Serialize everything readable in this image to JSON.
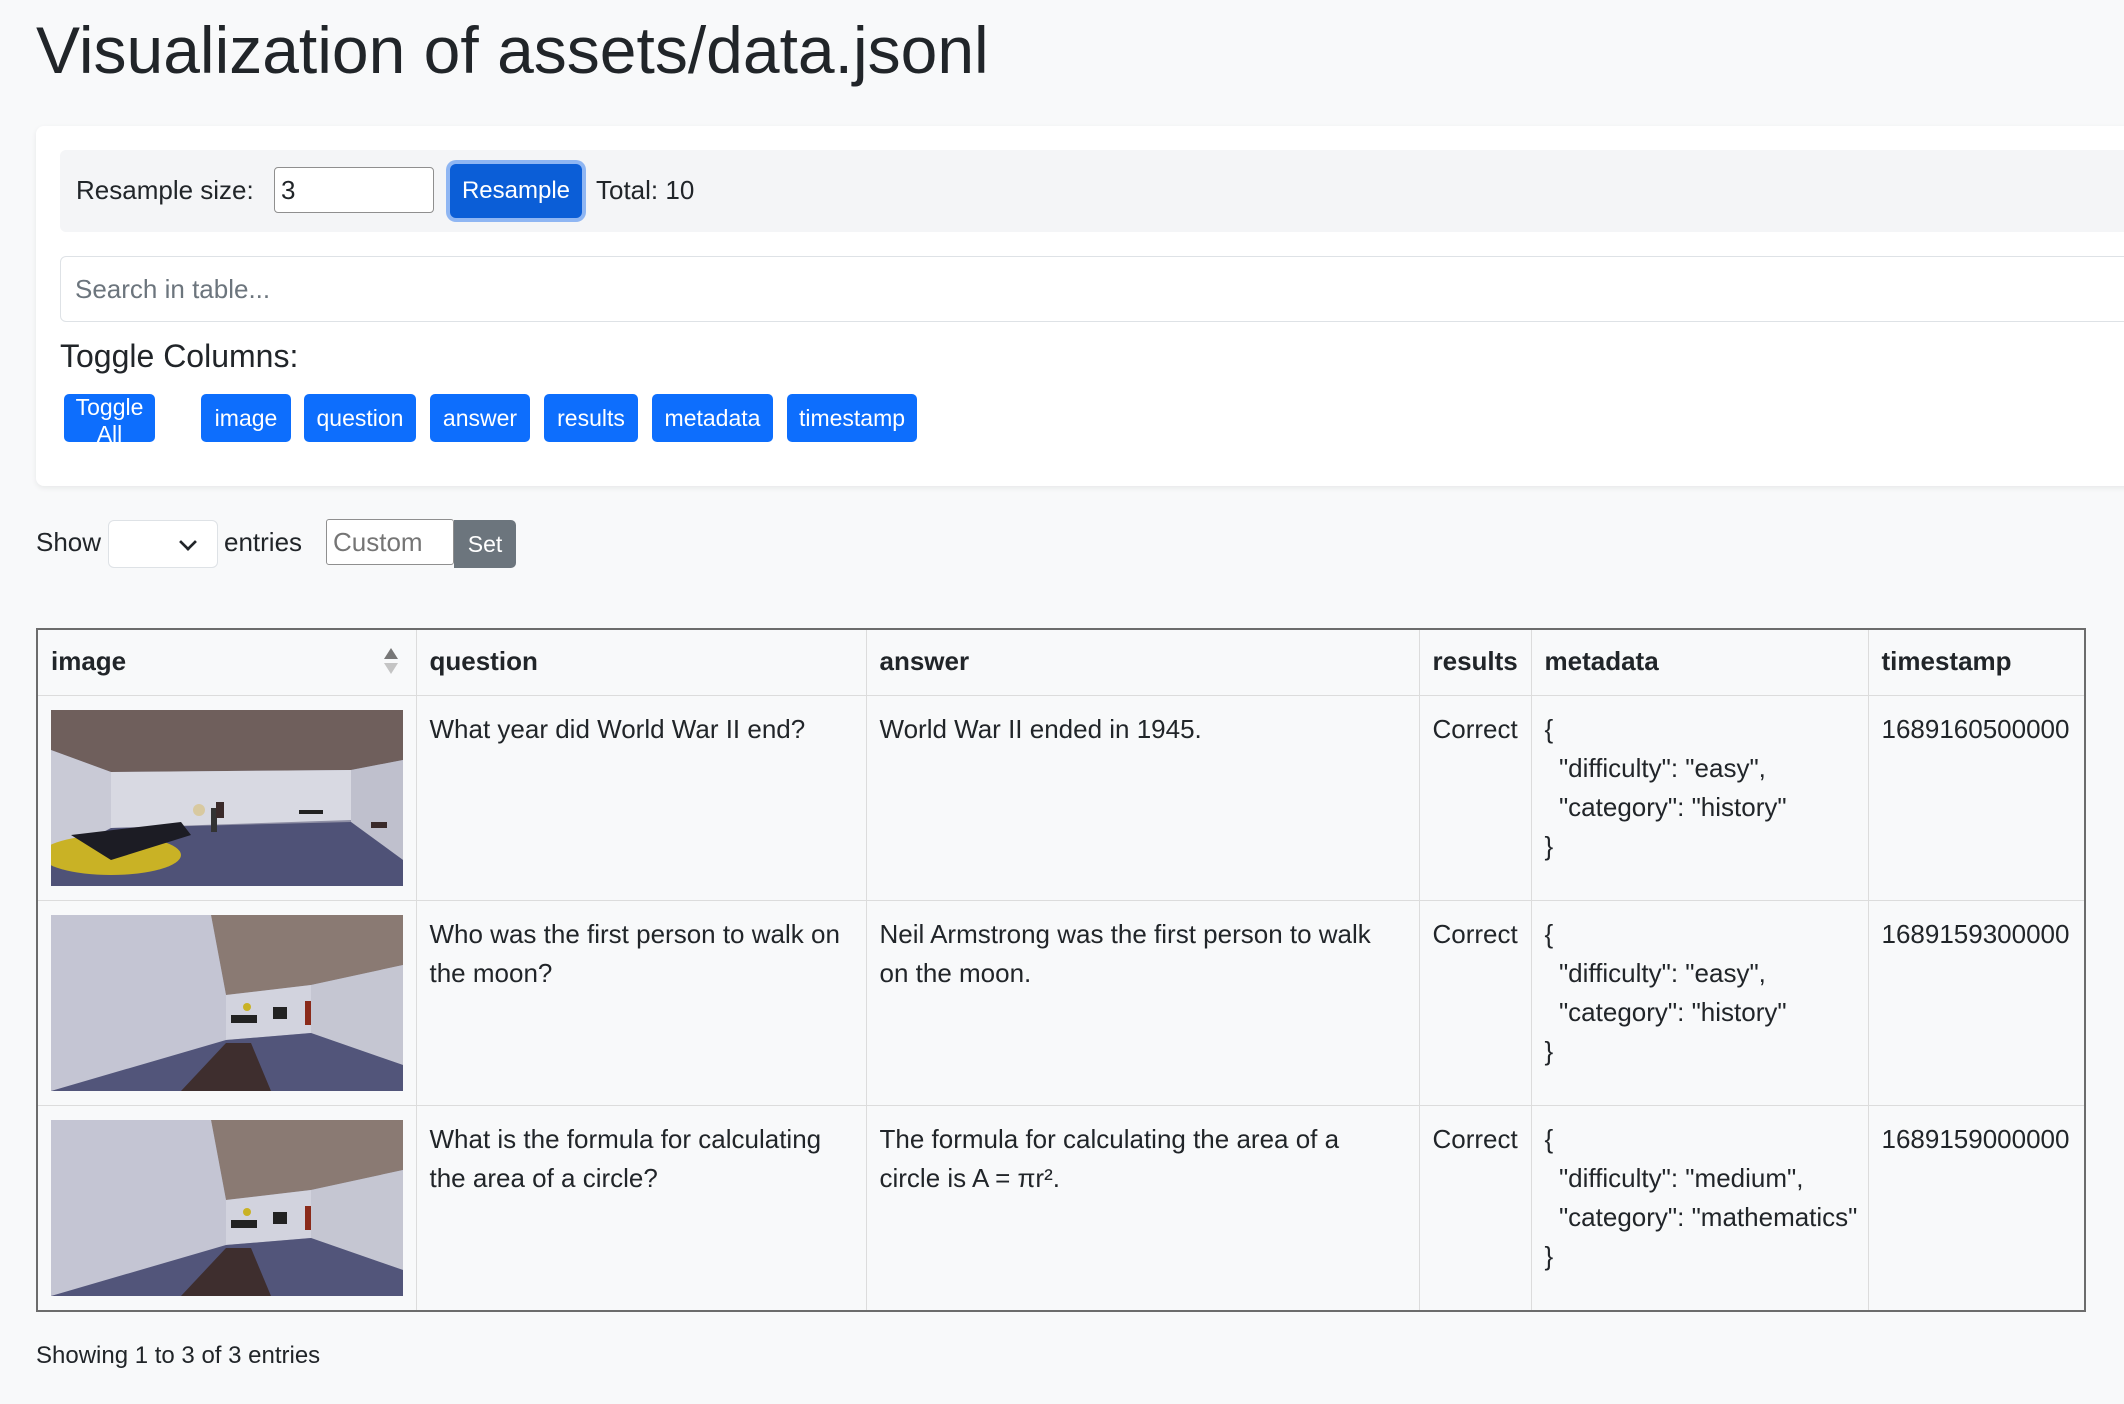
{
  "page": {
    "title": "Visualization of assets/data.jsonl"
  },
  "resample": {
    "label": "Resample size:",
    "value": "3",
    "button_label": "Resample",
    "total_text": "Total: 10"
  },
  "search": {
    "placeholder": "Search in table..."
  },
  "toggle": {
    "heading": "Toggle Columns:",
    "buttons": [
      "Toggle All",
      "image",
      "question",
      "answer",
      "results",
      "metadata",
      "timestamp"
    ]
  },
  "entries": {
    "show_label": "Show",
    "selected": "",
    "entries_label": "entries",
    "custom_placeholder": "Custom",
    "set_label": "Set"
  },
  "table": {
    "columns": [
      "image",
      "question",
      "answer",
      "results",
      "metadata",
      "timestamp"
    ],
    "rows": [
      {
        "image": "room-render-1",
        "question": "What year did World War II end?",
        "answer": "World War II ended in 1945.",
        "results": "Correct",
        "metadata": "{\n  \"difficulty\": \"easy\",\n  \"category\": \"history\"\n}",
        "timestamp": "1689160500000"
      },
      {
        "image": "room-render-2",
        "question": "Who was the first person to walk on the moon?",
        "answer": "Neil Armstrong was the first person to walk on the moon.",
        "results": "Correct",
        "metadata": "{\n  \"difficulty\": \"easy\",\n  \"category\": \"history\"\n}",
        "timestamp": "1689159300000"
      },
      {
        "image": "room-render-3",
        "question": "What is the formula for calculating the area of a circle?",
        "answer": "The formula for calculating the area of a circle is A = πr².",
        "results": "Correct",
        "metadata": "{\n  \"difficulty\": \"medium\",\n  \"category\": \"mathematics\"\n}",
        "timestamp": "1689159000000"
      }
    ]
  },
  "footer": {
    "summary": "Showing 1 to 3 of 3 entries"
  },
  "colors": {
    "primary": "#0d6efd",
    "secondary": "#6c757d",
    "background": "#f8f9fa"
  }
}
